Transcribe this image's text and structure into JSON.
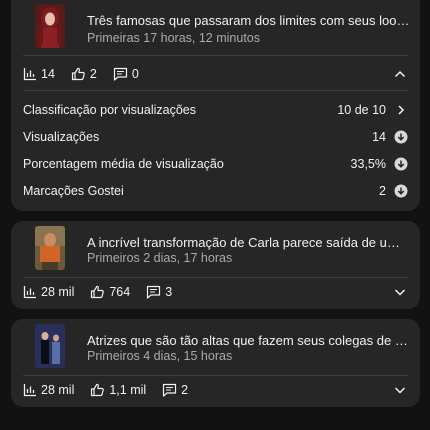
{
  "videos": [
    {
      "title": "Três famosas que passaram dos limites com seus looks em t...",
      "subtitle": "Primeiras 17 horas, 12 minutos",
      "views": "14",
      "likes": "2",
      "comments": "0",
      "expanded": true,
      "metrics": [
        {
          "label": "Classificação por visualizações",
          "value": "10 de 10",
          "icon": "chevron-right-icon"
        },
        {
          "label": "Visualizações",
          "value": "14",
          "icon": "arrow-down-circle-icon"
        },
        {
          "label": "Porcentagem média de visualização",
          "value": "33,5%",
          "icon": "arrow-down-circle-icon"
        },
        {
          "label": "Marcações Gostei",
          "value": "2",
          "icon": "arrow-down-circle-icon"
        }
      ]
    },
    {
      "title": "A incrível transformação de Carla parece saída de um filme #...",
      "subtitle": "Primeiros 2 dias, 17 horas",
      "views": "28 mil",
      "likes": "764",
      "comments": "3",
      "expanded": false
    },
    {
      "title": "Atrizes que são tão altas que fazem seus colegas de elenco p...",
      "subtitle": "Primeiros 4 dias, 15 horas",
      "views": "28 mil",
      "likes": "1,1 mil",
      "comments": "2",
      "expanded": false
    }
  ],
  "colors": {
    "background": "#121212",
    "card": "#262626",
    "text": "#f1f1f1",
    "secondary_text": "#aaaaaa"
  }
}
